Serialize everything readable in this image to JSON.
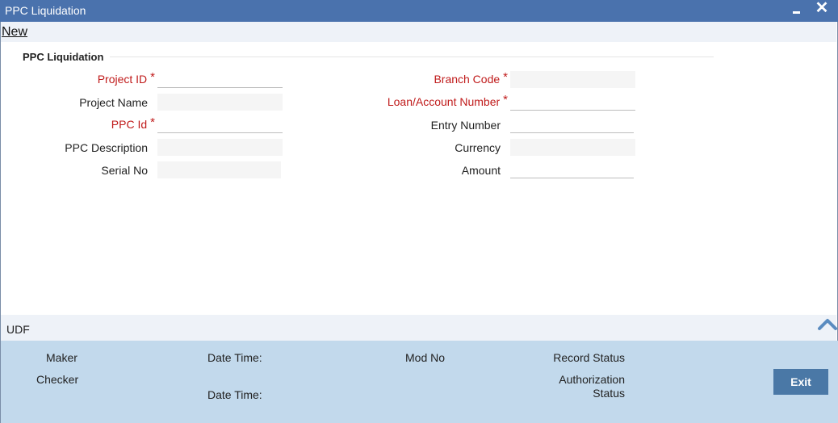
{
  "window": {
    "title": "PPC Liquidation",
    "close_glyph": "✕"
  },
  "menu": {
    "new_label": "New"
  },
  "section": {
    "title": "PPC Liquidation"
  },
  "form": {
    "project_id": {
      "label": "Project ID",
      "value": ""
    },
    "project_name": {
      "label": "Project Name",
      "value": ""
    },
    "ppc_id": {
      "label": "PPC Id",
      "value": ""
    },
    "ppc_description": {
      "label": "PPC Description",
      "value": ""
    },
    "serial_no": {
      "label": "Serial No",
      "value": ""
    },
    "branch_code": {
      "label": "Branch Code",
      "value": ""
    },
    "loan_account_number": {
      "label": "Loan/Account Number",
      "value": ""
    },
    "entry_number": {
      "label": "Entry Number",
      "value": ""
    },
    "currency": {
      "label": "Currency",
      "value": ""
    },
    "amount": {
      "label": "Amount",
      "value": ""
    },
    "required_marker": "*"
  },
  "udf": {
    "label": "UDF",
    "icon": "chevron-up-icon"
  },
  "footer": {
    "maker": "Maker",
    "checker": "Checker",
    "date_time_1": "Date Time:",
    "date_time_2": "Date Time:",
    "mod_no": "Mod No",
    "record_status": "Record Status",
    "authorization_line1": "Authorization",
    "authorization_line2": "Status",
    "exit_label": "Exit"
  },
  "colors": {
    "titlebar": "#4a72ad",
    "required": "#c01b1b",
    "footer": "#c2d9ec",
    "exit_button": "#4a78a6",
    "chevron": "#5b8cc0"
  }
}
